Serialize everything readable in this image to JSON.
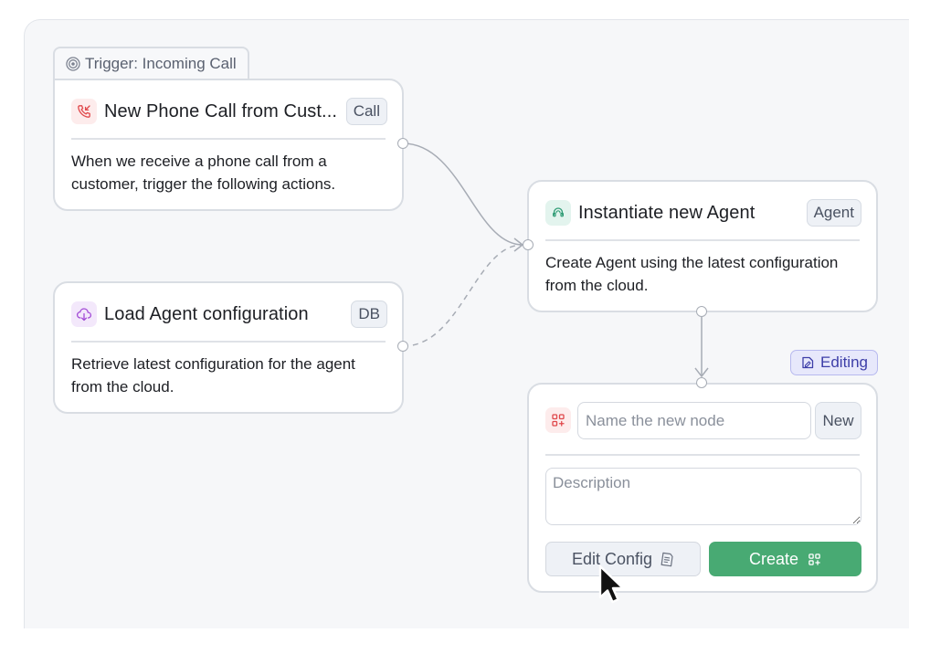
{
  "trigger_tab": {
    "label": "Trigger: Incoming Call",
    "icon": "radio-waves-icon"
  },
  "nodes": {
    "phone_call": {
      "title": "New Phone Call from Cust...",
      "tag": "Call",
      "description": "When we receive a phone call from a customer, trigger the following actions.",
      "icon": "phone-incoming-icon",
      "accent_color": "#e0484b"
    },
    "load_config": {
      "title": "Load Agent configuration",
      "tag": "DB",
      "description": "Retrieve latest configuration for the agent from the cloud.",
      "icon": "cloud-download-icon",
      "accent_color": "#a24bd6"
    },
    "instantiate_agent": {
      "title": "Instantiate new Agent",
      "tag": "Agent",
      "description": "Create Agent using the latest configuration from the cloud.",
      "icon": "agent-headset-icon",
      "accent_color": "#2e9b74"
    },
    "new_node": {
      "editing_label": "Editing",
      "editing_icon": "edit-note-icon",
      "name_placeholder": "Name the new node",
      "name_value": "",
      "tag": "New",
      "description_placeholder": "Description",
      "description_value": "",
      "icon": "grid-add-icon",
      "accent_color": "#e0484b",
      "edit_config_label": "Edit Config",
      "edit_config_icon": "document-icon",
      "create_label": "Create",
      "create_icon": "grid-add-icon",
      "create_color": "#48aa73"
    }
  }
}
